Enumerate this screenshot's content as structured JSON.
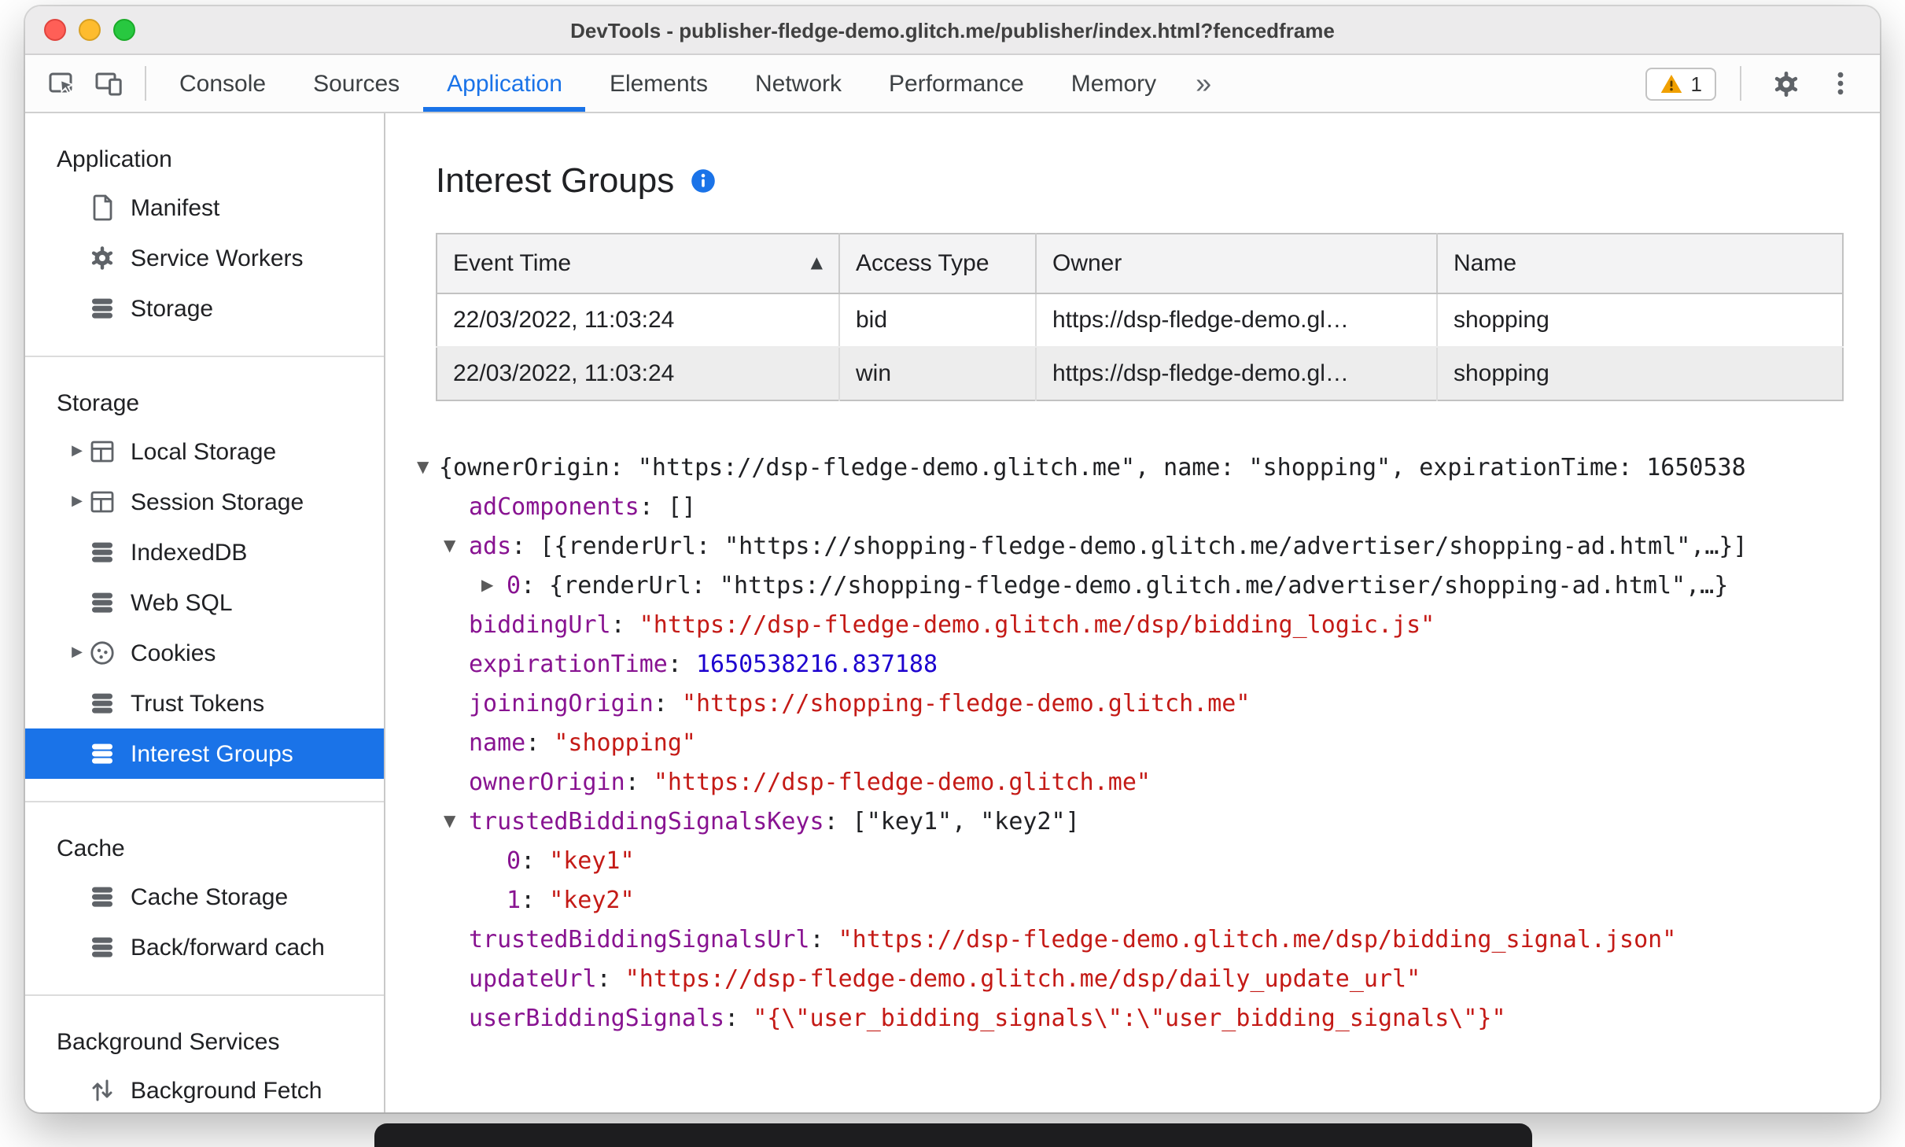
{
  "window": {
    "title": "DevTools - publisher-fledge-demo.glitch.me/publisher/index.html?fencedframe"
  },
  "toolbar": {
    "left_icons": [
      "inspect-element-icon",
      "device-toolbar-icon"
    ],
    "tabs": [
      {
        "label": "Console",
        "active": false
      },
      {
        "label": "Sources",
        "active": false
      },
      {
        "label": "Application",
        "active": true
      },
      {
        "label": "Elements",
        "active": false
      },
      {
        "label": "Network",
        "active": false
      },
      {
        "label": "Performance",
        "active": false
      },
      {
        "label": "Memory",
        "active": false
      }
    ],
    "more_tabs_label": "»",
    "warning_count": "1",
    "right_icons": [
      "warning-icon",
      "settings-gear-icon",
      "more-options-icon"
    ]
  },
  "sidebar": {
    "sections": [
      {
        "title": "Application",
        "items": [
          {
            "label": "Manifest",
            "icon": "file-icon",
            "expandable": false,
            "selected": false
          },
          {
            "label": "Service Workers",
            "icon": "gear-icon",
            "expandable": false,
            "selected": false
          },
          {
            "label": "Storage",
            "icon": "database-icon",
            "expandable": false,
            "selected": false
          }
        ]
      },
      {
        "title": "Storage",
        "items": [
          {
            "label": "Local Storage",
            "icon": "table-icon",
            "expandable": true,
            "selected": false
          },
          {
            "label": "Session Storage",
            "icon": "table-icon",
            "expandable": true,
            "selected": false
          },
          {
            "label": "IndexedDB",
            "icon": "database-icon",
            "expandable": false,
            "selected": false
          },
          {
            "label": "Web SQL",
            "icon": "database-icon",
            "expandable": false,
            "selected": false
          },
          {
            "label": "Cookies",
            "icon": "cookie-icon",
            "expandable": true,
            "selected": false
          },
          {
            "label": "Trust Tokens",
            "icon": "database-icon",
            "expandable": false,
            "selected": false
          },
          {
            "label": "Interest Groups",
            "icon": "database-icon",
            "expandable": false,
            "selected": true
          }
        ]
      },
      {
        "title": "Cache",
        "items": [
          {
            "label": "Cache Storage",
            "icon": "database-icon",
            "expandable": false,
            "selected": false
          },
          {
            "label": "Back/forward cach",
            "icon": "database-icon",
            "expandable": false,
            "selected": false
          }
        ]
      },
      {
        "title": "Background Services",
        "items": [
          {
            "label": "Background Fetch",
            "icon": "fetch-icon",
            "expandable": false,
            "selected": false
          }
        ]
      }
    ]
  },
  "main": {
    "title": "Interest Groups",
    "info_icon": "info-icon",
    "table": {
      "columns": [
        "Event Time",
        "Access Type",
        "Owner",
        "Name"
      ],
      "sort": {
        "column": "Event Time",
        "direction": "ascending"
      },
      "rows": [
        {
          "event_time": "22/03/2022, 11:03:24",
          "access_type": "bid",
          "owner": "https://dsp-fledge-demo.gl…",
          "name": "shopping",
          "highlighted": false
        },
        {
          "event_time": "22/03/2022, 11:03:24",
          "access_type": "win",
          "owner": "https://dsp-fledge-demo.gl…",
          "name": "shopping",
          "highlighted": true
        }
      ]
    },
    "tree": {
      "lines": [
        {
          "key": "root",
          "indent": 0,
          "arrow": "down",
          "tokens": [
            {
              "c": "plain",
              "v": "{ownerOrigin: \"https://dsp-fledge-demo.glitch.me\", name: \"shopping\", expirationTime: 1650538"
            }
          ]
        },
        {
          "key": "adComponents",
          "indent": 1,
          "tokens": [
            {
              "c": "key",
              "v": "adComponents"
            },
            {
              "c": "plain",
              "v": ": []"
            }
          ]
        },
        {
          "key": "ads",
          "indent": 1,
          "arrow": "down",
          "tokens": [
            {
              "c": "key",
              "v": "ads"
            },
            {
              "c": "plain",
              "v": ": [{renderUrl: \"https://shopping-fledge-demo.glitch.me/advertiser/shopping-ad.html\",…}]"
            }
          ]
        },
        {
          "key": "ads-0",
          "indent": 2,
          "arrow": "right",
          "tokens": [
            {
              "c": "key",
              "v": "0"
            },
            {
              "c": "plain",
              "v": ": {renderUrl: \"https://shopping-fledge-demo.glitch.me/advertiser/shopping-ad.html\",…}"
            }
          ]
        },
        {
          "key": "biddingUrl",
          "indent": 1,
          "tokens": [
            {
              "c": "key",
              "v": "biddingUrl"
            },
            {
              "c": "plain",
              "v": ": "
            },
            {
              "c": "string",
              "v": "\"https://dsp-fledge-demo.glitch.me/dsp/bidding_logic.js\""
            }
          ]
        },
        {
          "key": "expirationTime",
          "indent": 1,
          "tokens": [
            {
              "c": "key",
              "v": "expirationTime"
            },
            {
              "c": "plain",
              "v": ": "
            },
            {
              "c": "number",
              "v": "1650538216.837188"
            }
          ]
        },
        {
          "key": "joiningOrigin",
          "indent": 1,
          "tokens": [
            {
              "c": "key",
              "v": "joiningOrigin"
            },
            {
              "c": "plain",
              "v": ": "
            },
            {
              "c": "string",
              "v": "\"https://shopping-fledge-demo.glitch.me\""
            }
          ]
        },
        {
          "key": "name",
          "indent": 1,
          "tokens": [
            {
              "c": "key",
              "v": "name"
            },
            {
              "c": "plain",
              "v": ": "
            },
            {
              "c": "string",
              "v": "\"shopping\""
            }
          ]
        },
        {
          "key": "ownerOrigin",
          "indent": 1,
          "tokens": [
            {
              "c": "key",
              "v": "ownerOrigin"
            },
            {
              "c": "plain",
              "v": ": "
            },
            {
              "c": "string",
              "v": "\"https://dsp-fledge-demo.glitch.me\""
            }
          ]
        },
        {
          "key": "trustedBiddingSignalsKeys",
          "indent": 1,
          "arrow": "down",
          "tokens": [
            {
              "c": "key",
              "v": "trustedBiddingSignalsKeys"
            },
            {
              "c": "plain",
              "v": ": [\"key1\", \"key2\"]"
            }
          ]
        },
        {
          "key": "trustedBiddingSignalsKeys-0",
          "indent": 2,
          "tokens": [
            {
              "c": "key",
              "v": "0"
            },
            {
              "c": "plain",
              "v": ": "
            },
            {
              "c": "string",
              "v": "\"key1\""
            }
          ]
        },
        {
          "key": "trustedBiddingSignalsKeys-1",
          "indent": 2,
          "tokens": [
            {
              "c": "key",
              "v": "1"
            },
            {
              "c": "plain",
              "v": ": "
            },
            {
              "c": "string",
              "v": "\"key2\""
            }
          ]
        },
        {
          "key": "trustedBiddingSignalsUrl",
          "indent": 1,
          "tokens": [
            {
              "c": "key",
              "v": "trustedBiddingSignalsUrl"
            },
            {
              "c": "plain",
              "v": ": "
            },
            {
              "c": "string",
              "v": "\"https://dsp-fledge-demo.glitch.me/dsp/bidding_signal.json\""
            }
          ]
        },
        {
          "key": "updateUrl",
          "indent": 1,
          "tokens": [
            {
              "c": "key",
              "v": "updateUrl"
            },
            {
              "c": "plain",
              "v": ": "
            },
            {
              "c": "string",
              "v": "\"https://dsp-fledge-demo.glitch.me/dsp/daily_update_url\""
            }
          ]
        },
        {
          "key": "userBiddingSignals",
          "indent": 1,
          "tokens": [
            {
              "c": "key",
              "v": "userBiddingSignals"
            },
            {
              "c": "plain",
              "v": ": "
            },
            {
              "c": "string",
              "v": "\"{\\\"user_bidding_signals\\\":\\\"user_bidding_signals\\\"}\""
            }
          ]
        }
      ]
    }
  },
  "colors": {
    "accent_blue": "#1a73e8",
    "selection_blue": "#1a73e8",
    "key_purple": "#881391",
    "string_red": "#c41a16",
    "number_blue": "#1c00cf",
    "warning_yellow": "#f0a000"
  }
}
